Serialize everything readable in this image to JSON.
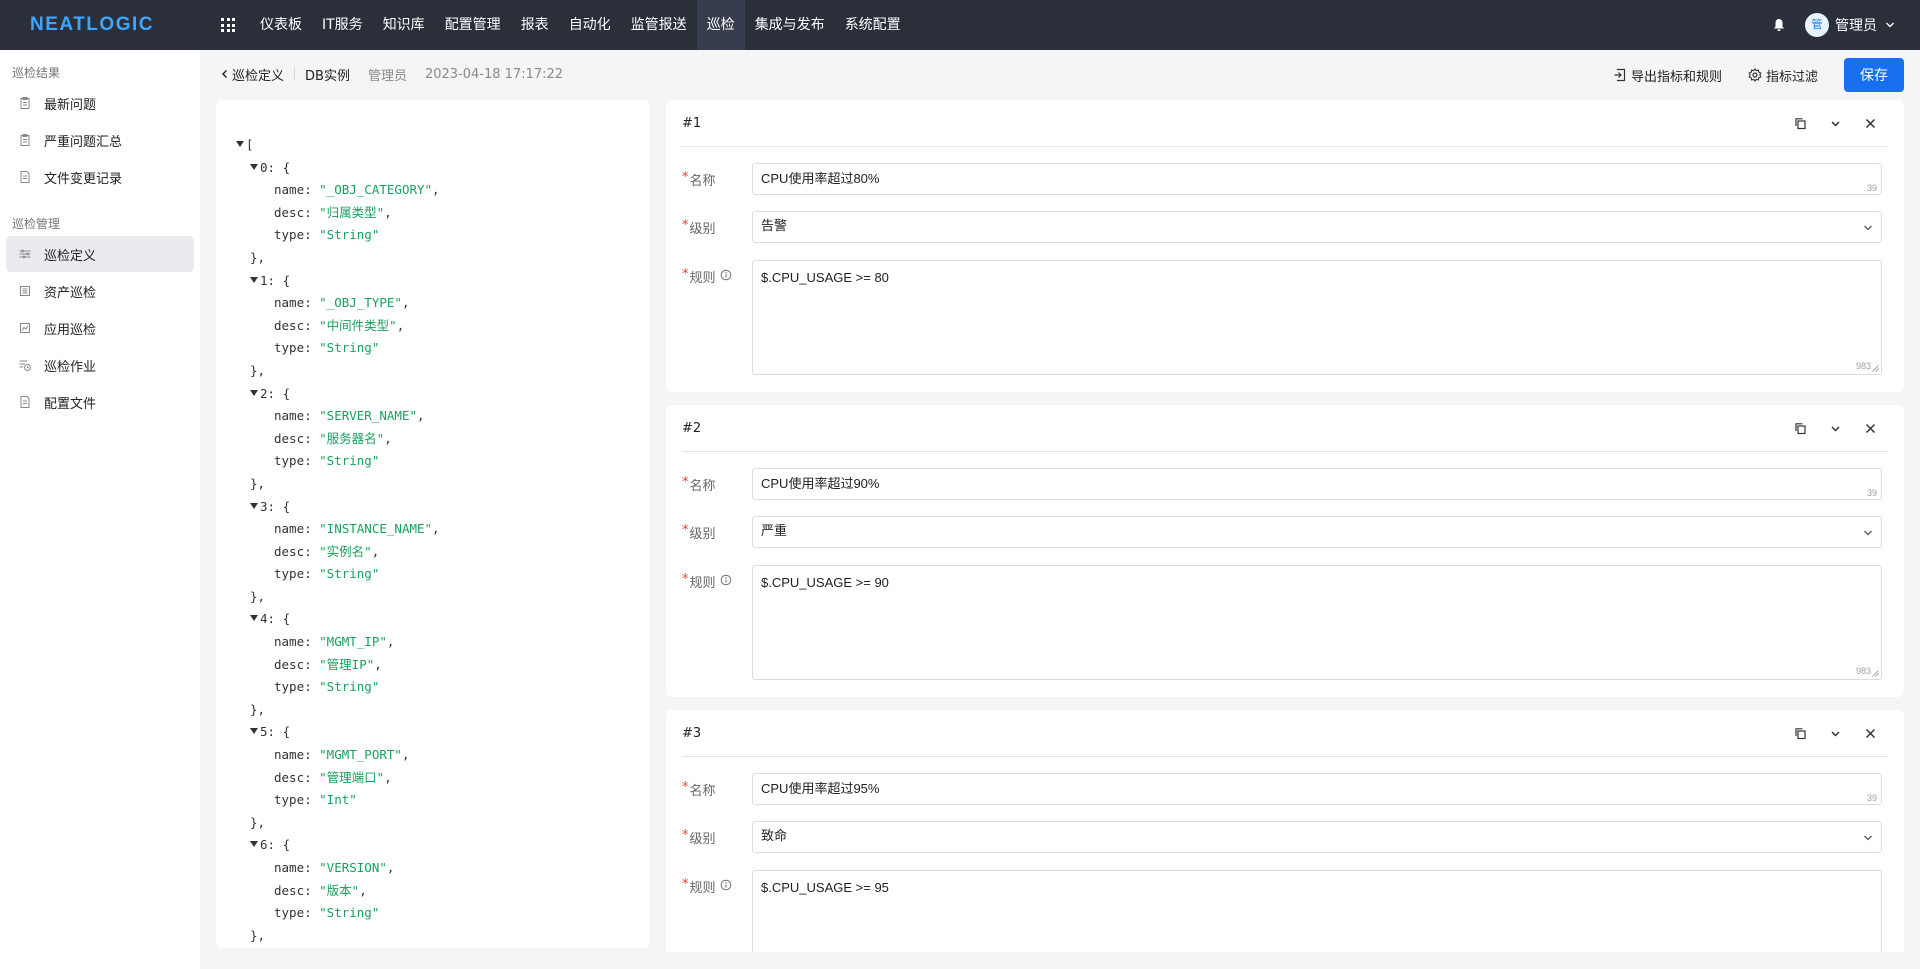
{
  "nav": {
    "logo": "NEATLOGIC",
    "menu": [
      "仪表板",
      "IT服务",
      "知识库",
      "配置管理",
      "报表",
      "自动化",
      "监管报送",
      "巡检",
      "集成与发布",
      "系统配置"
    ],
    "active_menu": "巡检",
    "user": {
      "avatar_text": "管",
      "name": "管理员"
    }
  },
  "sidebar": {
    "group1": "巡检结果",
    "items1": [
      "最新问题",
      "严重问题汇总",
      "文件变更记录"
    ],
    "group2": "巡检管理",
    "items2": [
      "巡检定义",
      "资产巡检",
      "应用巡检",
      "巡检作业",
      "配置文件"
    ],
    "active_item": "巡检定义"
  },
  "header": {
    "back_label": "巡检定义",
    "title": "DB实例",
    "author": "管理员",
    "time": "2023-04-18 17:17:22",
    "export_label": "导出指标和规则",
    "filter_label": "指标过滤",
    "save_label": "保存"
  },
  "json_view": {
    "open_bracket": "[",
    "entries": [
      {
        "index": "0",
        "name": "\"_OBJ_CATEGORY\"",
        "desc": "\"归属类型\"",
        "type": "\"String\""
      },
      {
        "index": "1",
        "name": "\"_OBJ_TYPE\"",
        "desc": "\"中间件类型\"",
        "type": "\"String\""
      },
      {
        "index": "2",
        "name": "\"SERVER_NAME\"",
        "desc": "\"服务器名\"",
        "type": "\"String\""
      },
      {
        "index": "3",
        "name": "\"INSTANCE_NAME\"",
        "desc": "\"实例名\"",
        "type": "\"String\""
      },
      {
        "index": "4",
        "name": "\"MGMT_IP\"",
        "desc": "\"管理IP\"",
        "type": "\"String\""
      },
      {
        "index": "5",
        "name": "\"MGMT_PORT\"",
        "desc": "\"管理端口\"",
        "type": "\"Int\""
      },
      {
        "index": "6",
        "name": "\"VERSION\"",
        "desc": "\"版本\"",
        "type": "\"String\""
      }
    ]
  },
  "rules": {
    "labels": {
      "name": "名称",
      "level": "级别",
      "rule": "规则"
    },
    "cards": [
      {
        "no": "#1",
        "name": "CPU使用率超过80%",
        "name_count": "39",
        "level": "告警",
        "rule": "$.CPU_USAGE >= 80",
        "rule_count": "983"
      },
      {
        "no": "#2",
        "name": "CPU使用率超过90%",
        "name_count": "39",
        "level": "严重",
        "rule": "$.CPU_USAGE >= 90",
        "rule_count": "983"
      },
      {
        "no": "#3",
        "name": "CPU使用率超过95%",
        "name_count": "39",
        "level": "致命",
        "rule": "$.CPU_USAGE >= 95",
        "rule_count": "983"
      }
    ]
  }
}
